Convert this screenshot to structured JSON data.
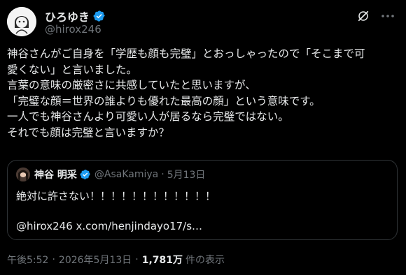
{
  "author": {
    "display_name": "ひろゆき",
    "handle": "@hirox246"
  },
  "tweet": {
    "text": "神谷さんがご自身を「学歴も顔も完璧」とおっしゃったので「そこまで可\n愛くない」と言いました。\n言葉の意味の厳密さに共感していたと思いますが、\n「完璧な顔＝世界の誰よりも優れた最高の顔」という意味です。\n一人でも神谷さんより可愛い人が居るなら完璧ではない。\nそれでも顔は完璧と言いますか？"
  },
  "quote": {
    "display_name": "神谷 明采",
    "handle": "@AsaKamiya",
    "separator": "·",
    "date": "5月13日",
    "line1": "絶対に許さない！！！！！！！！！！！！",
    "line2": "@hirox246 x.com/henjindayo17/s…"
  },
  "meta": {
    "time": "午後5:52",
    "separator": "·",
    "date": "2026年5月13日",
    "views_count": "1,781万",
    "views_label": "件の表示"
  },
  "colors": {
    "background": "#000000",
    "text": "#e7e9ea",
    "secondary": "#71767b",
    "verified": "#1d9bf0",
    "border": "#2f3336"
  },
  "icons": [
    "avatar",
    "verified-badge-icon",
    "grok-icon",
    "more-icon"
  ]
}
